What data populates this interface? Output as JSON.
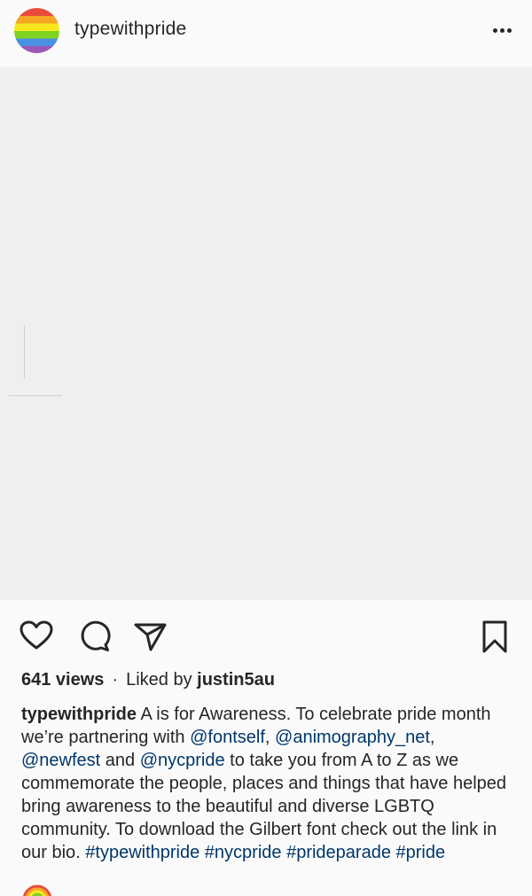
{
  "post": {
    "username": "typewithpride",
    "avatar_icon": "rainbow-flag-avatar",
    "more_icon": "more-options-icon"
  },
  "colors": {
    "text": "#262626",
    "link": "#00376b",
    "media_background": "#efefef",
    "rainbow": [
      "#e94b3c",
      "#f5a623",
      "#f8e71c",
      "#7ed321",
      "#4a90e2",
      "#9b59b6"
    ]
  },
  "actions": {
    "like_icon": "heart-icon",
    "comment_icon": "comment-icon",
    "share_icon": "paper-plane-icon",
    "save_icon": "bookmark-icon"
  },
  "stats": {
    "views": "641 views",
    "separator": "·",
    "liked_by_prefix": "Liked by",
    "liked_by_user": "justin5au"
  },
  "caption": {
    "username": "typewithpride",
    "text_1": " A is for Awareness. To celebrate pride month we’re partnering with ",
    "mention_1": "@fontself",
    "text_2": ", ",
    "mention_2": "@animography_net",
    "text_3": ", ",
    "mention_3": "@newfest",
    "text_4": " and ",
    "mention_4": "@nycpride",
    "text_5": " to take you from A to Z as we commemorate the people, places and things that have helped bring awareness to the beautiful and diverse LGBTQ community. To download the Gilbert font check out the link in our bio. ",
    "hashtag_1": "#typewithpride",
    "hashtag_2": "#nycpride",
    "hashtag_3": "#prideparade",
    "hashtag_4": "#pride",
    "space": " ",
    "trailing_emoji": "rainbow-emoji"
  }
}
